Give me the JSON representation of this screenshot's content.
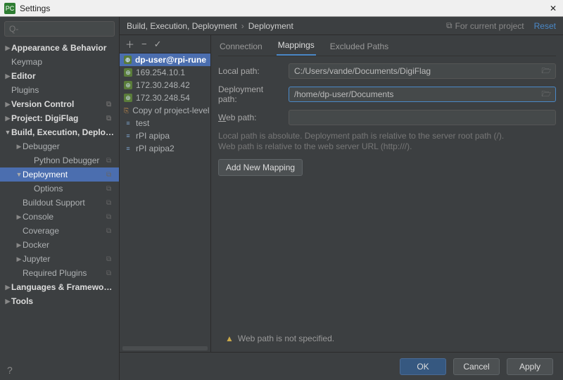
{
  "window": {
    "title": "Settings"
  },
  "search": {
    "placeholder": "Q-"
  },
  "tree": [
    {
      "label": "Appearance & Behavior",
      "depth": 0,
      "arrow": "▶",
      "bold": true
    },
    {
      "label": "Keymap",
      "depth": 0,
      "arrow": ""
    },
    {
      "label": "Editor",
      "depth": 0,
      "arrow": "▶",
      "bold": true
    },
    {
      "label": "Plugins",
      "depth": 0,
      "arrow": ""
    },
    {
      "label": "Version Control",
      "depth": 0,
      "arrow": "▶",
      "bold": true,
      "cfg": true
    },
    {
      "label": "Project: DigiFlag",
      "depth": 0,
      "arrow": "▶",
      "bold": true,
      "cfg": true
    },
    {
      "label": "Build, Execution, Deployment",
      "depth": 0,
      "arrow": "▼",
      "bold": true,
      "open": true
    },
    {
      "label": "Debugger",
      "depth": 1,
      "arrow": "▶"
    },
    {
      "label": "Python Debugger",
      "depth": 2,
      "arrow": "",
      "cfg": true
    },
    {
      "label": "Deployment",
      "depth": 1,
      "arrow": "▼",
      "cfg": true,
      "sel": true,
      "open": true
    },
    {
      "label": "Options",
      "depth": 2,
      "arrow": "",
      "cfg": true
    },
    {
      "label": "Buildout Support",
      "depth": 1,
      "arrow": "",
      "cfg": true
    },
    {
      "label": "Console",
      "depth": 1,
      "arrow": "▶",
      "cfg": true
    },
    {
      "label": "Coverage",
      "depth": 1,
      "arrow": "",
      "cfg": true
    },
    {
      "label": "Docker",
      "depth": 1,
      "arrow": "▶"
    },
    {
      "label": "Jupyter",
      "depth": 1,
      "arrow": "▶",
      "cfg": true
    },
    {
      "label": "Required Plugins",
      "depth": 1,
      "arrow": "",
      "cfg": true
    },
    {
      "label": "Languages & Frameworks",
      "depth": 0,
      "arrow": "▶",
      "bold": true
    },
    {
      "label": "Tools",
      "depth": 0,
      "arrow": "▶",
      "bold": true
    }
  ],
  "crumbs": {
    "a": "Build, Execution, Deployment",
    "b": "Deployment",
    "proj": "For current project",
    "reset": "Reset"
  },
  "servers": [
    {
      "label": "dp-user@rpi-rune",
      "icon": "web",
      "sel": true,
      "bold": true
    },
    {
      "label": "169.254.10.1",
      "icon": "web"
    },
    {
      "label": "172.30.248.42",
      "icon": "web"
    },
    {
      "label": "172.30.248.54",
      "icon": "web"
    },
    {
      "label": "Copy of project-level serv",
      "icon": "copy"
    },
    {
      "label": "test",
      "icon": "file"
    },
    {
      "label": "rPI apipa",
      "icon": "file"
    },
    {
      "label": "rPI apipa2",
      "icon": "file"
    }
  ],
  "tabs": {
    "t0": "Connection",
    "t1": "Mappings",
    "t2": "Excluded Paths"
  },
  "form": {
    "local_lbl": "Local path:",
    "local_val": "C:/Users/vande/Documents/DigiFlag",
    "deploy_lbl": "Deployment path:",
    "deploy_val": "/home/dp-user/Documents",
    "web_lbl": "Web path:",
    "web_val": "",
    "hint1": "Local path is absolute. Deployment path is relative to the server root path (/).",
    "hint2": "Web path is relative to the web server URL (http:///).",
    "add": "Add New Mapping"
  },
  "warn": "Web path is not specified.",
  "footer": {
    "ok": "OK",
    "cancel": "Cancel",
    "apply": "Apply"
  }
}
